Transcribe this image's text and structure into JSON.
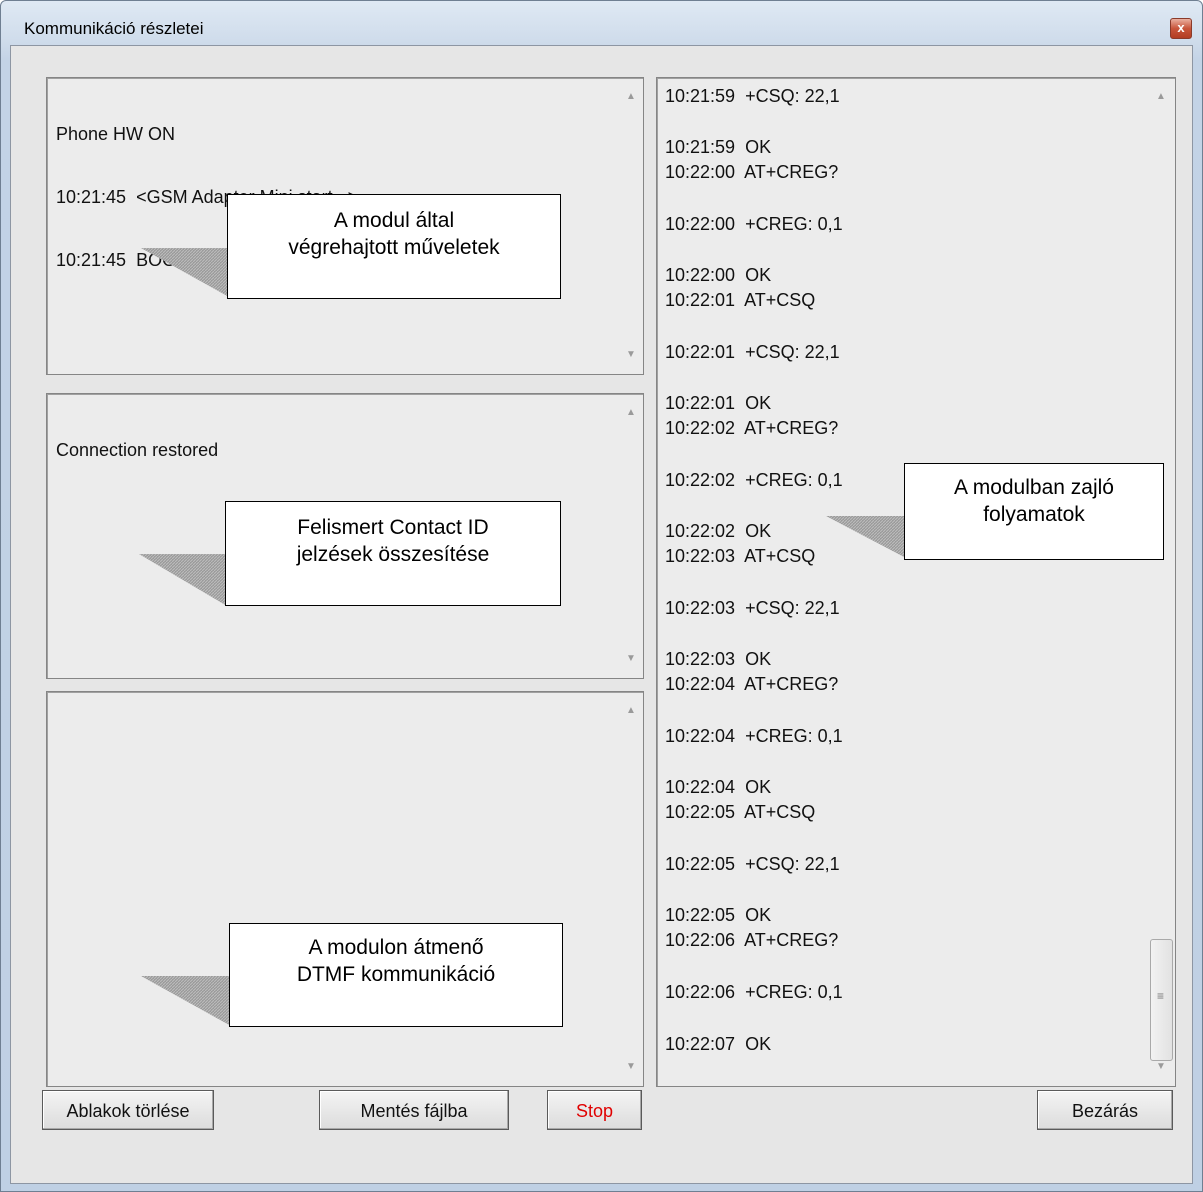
{
  "window": {
    "title": "Kommunikáció részletei",
    "close_glyph": "x"
  },
  "panels": {
    "operations": {
      "lines": [
        "Phone HW ON",
        "10:21:45  <GSM Adapter Mini start...>",
        "10:21:45  BOOT GSM TYPE: S300"
      ],
      "note": "A modul által\nvégrehajtott műveletek"
    },
    "contact_id": {
      "lines": [
        "Connection restored"
      ],
      "note": "Felismert Contact ID\njelzések összesítése"
    },
    "dtmf": {
      "lines": [],
      "note": "A modulon átmenő\nDTMF kommunikáció"
    },
    "process": {
      "note": "A modulban zajló\nfolyamatok",
      "log": [
        "10:21:59  +CSQ: 22,1",
        "10:21:59  OK",
        "10:22:00  AT+CREG?",
        "10:22:00  +CREG: 0,1",
        "10:22:00  OK",
        "10:22:01  AT+CSQ",
        "10:22:01  +CSQ: 22,1",
        "10:22:01  OK",
        "10:22:02  AT+CREG?",
        "10:22:02  +CREG: 0,1",
        "10:22:02  OK",
        "10:22:03  AT+CSQ",
        "10:22:03  +CSQ: 22,1",
        "10:22:03  OK",
        "10:22:04  AT+CREG?",
        "10:22:04  +CREG: 0,1",
        "10:22:04  OK",
        "10:22:05  AT+CSQ",
        "10:22:05  +CSQ: 22,1",
        "10:22:05  OK",
        "10:22:06  AT+CREG?",
        "10:22:06  +CREG: 0,1",
        "10:22:07  OK"
      ]
    }
  },
  "buttons": {
    "clear": "Ablakok törlése",
    "save": "Mentés fájlba",
    "stop": "Stop",
    "close": "Bezárás"
  },
  "icons": {
    "scroll_up": "▲",
    "scroll_down": "▼",
    "grip": "≡"
  },
  "colors": {
    "stop_text": "#e00000",
    "frame": "#bfd0e4"
  }
}
